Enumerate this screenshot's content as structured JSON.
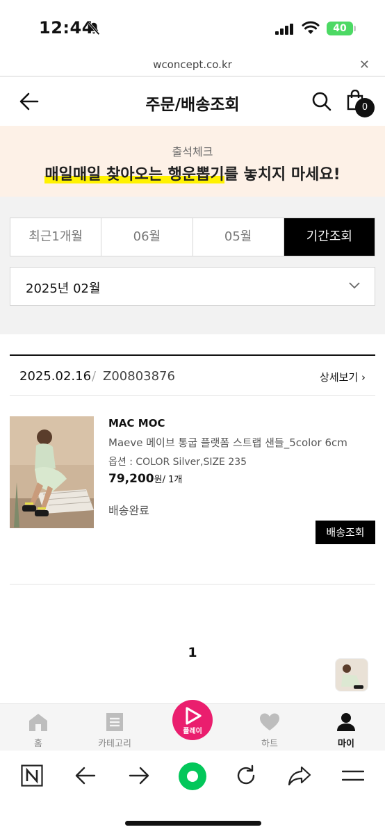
{
  "status_bar": {
    "time": "12:44",
    "battery": "40"
  },
  "url_bar": {
    "url": "wconcept.co.kr"
  },
  "header": {
    "title": "주문/배송조회",
    "cart_count": "0"
  },
  "banner": {
    "subtitle": "출석체크",
    "headline_highlight": "매일매일 찾아오는 행운뽑기",
    "headline_rest": "를 놓치지 마세요!"
  },
  "filter": {
    "tabs": [
      {
        "label": "최근1개월",
        "active": false
      },
      {
        "label": "06월",
        "active": false
      },
      {
        "label": "05월",
        "active": false
      },
      {
        "label": "기간조회",
        "active": true
      }
    ],
    "selected_month": "2025년 02월"
  },
  "order": {
    "date": "2025.02.16",
    "separator": "/",
    "number": "Z00803876",
    "detail_label": "상세보기",
    "item": {
      "brand": "MAC MOC",
      "name": "Maeve 메이브 통굽 플랫폼 스트랩 샌들_5color 6cm",
      "option": "옵션 : COLOR Silver,SIZE 235",
      "price": "79,200",
      "price_unit": "원/",
      "quantity": " 1개",
      "status": "배송완료",
      "track_label": "배송조회"
    }
  },
  "pagination": {
    "current": "1"
  },
  "bottom_nav": {
    "items": [
      {
        "label": "홈",
        "icon": "home-icon"
      },
      {
        "label": "카테고리",
        "icon": "category-icon"
      },
      {
        "label": "플레이",
        "icon": "play-icon"
      },
      {
        "label": "하트",
        "icon": "heart-icon"
      },
      {
        "label": "마이",
        "icon": "person-icon"
      }
    ]
  },
  "colors": {
    "accent_play": "#ea1e6e",
    "naver_green": "#03c75a",
    "banner_bg": "#fdf1e7",
    "highlight": "#fff200"
  }
}
